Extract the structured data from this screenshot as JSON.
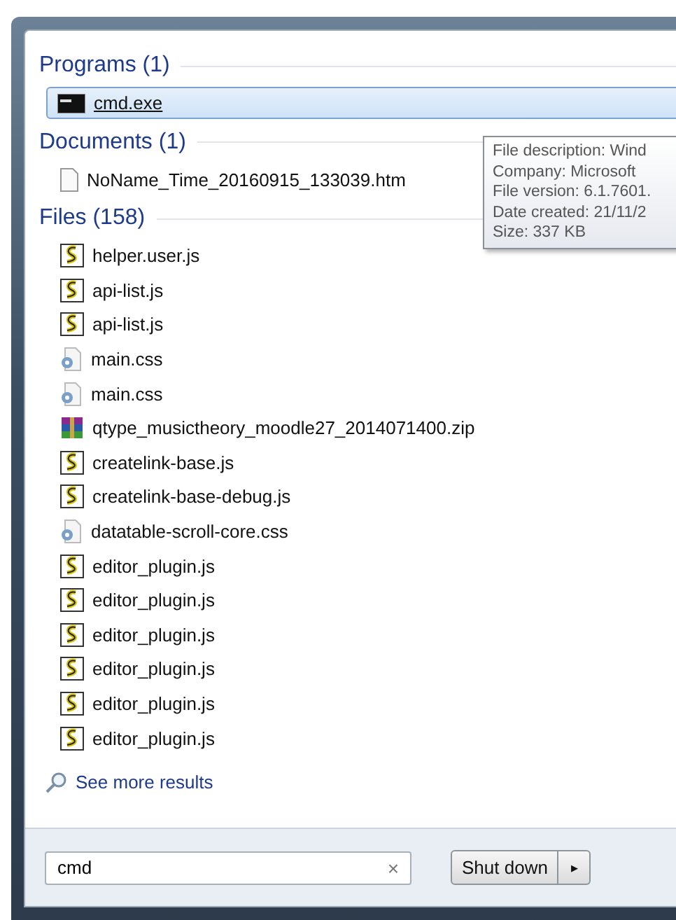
{
  "sections": [
    {
      "title": "Programs (1)",
      "items": [
        {
          "kind": "console",
          "name": "cmd.exe",
          "selected": true
        }
      ]
    },
    {
      "title": "Documents (1)",
      "items": [
        {
          "kind": "document",
          "name": "NoName_Time_20160915_133039.htm",
          "selected": false
        }
      ]
    },
    {
      "title": "Files (158)",
      "items": [
        {
          "kind": "script",
          "name": "helper.user.js",
          "selected": false
        },
        {
          "kind": "script",
          "name": "api-list.js",
          "selected": false
        },
        {
          "kind": "script",
          "name": "api-list.js",
          "selected": false
        },
        {
          "kind": "css",
          "name": "main.css",
          "selected": false
        },
        {
          "kind": "css",
          "name": "main.css",
          "selected": false
        },
        {
          "kind": "archive",
          "name": "qtype_musictheory_moodle27_2014071400.zip",
          "selected": false
        },
        {
          "kind": "script",
          "name": "createlink-base.js",
          "selected": false
        },
        {
          "kind": "script",
          "name": "createlink-base-debug.js",
          "selected": false
        },
        {
          "kind": "css",
          "name": "datatable-scroll-core.css",
          "selected": false
        },
        {
          "kind": "script",
          "name": "editor_plugin.js",
          "selected": false
        },
        {
          "kind": "script",
          "name": "editor_plugin.js",
          "selected": false
        },
        {
          "kind": "script",
          "name": "editor_plugin.js",
          "selected": false
        },
        {
          "kind": "script",
          "name": "editor_plugin.js",
          "selected": false
        },
        {
          "kind": "script",
          "name": "editor_plugin.js",
          "selected": false
        },
        {
          "kind": "script",
          "name": "editor_plugin.js",
          "selected": false
        }
      ]
    }
  ],
  "tooltip": [
    "File description: Wind",
    "Company: Microsoft",
    "File version: 6.1.7601.",
    "Date created: 21/11/2",
    "Size: 337 KB"
  ],
  "see_more": "See more results",
  "search": {
    "value": "cmd",
    "clear": "×"
  },
  "shutdown": {
    "label": "Shut down",
    "arrow": "▸"
  }
}
